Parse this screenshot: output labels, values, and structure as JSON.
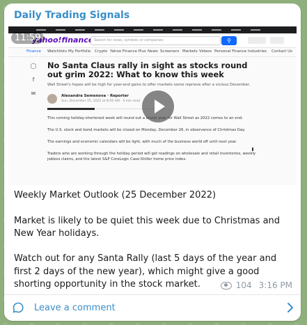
{
  "channel": {
    "name": "Daily Trading Signals"
  },
  "video": {
    "duration": "11:59",
    "screenshot": {
      "site_logo": "yahoo!finance",
      "search_placeholder": "Search for news, symbols or companies",
      "nav": [
        "Finance",
        "Watchlists",
        "My Portfolio",
        "Crypto",
        "Yahoo Finance Plus",
        "News",
        "Screeners",
        "Markets",
        "Videos",
        "Personal Finance",
        "Industries",
        "Contact Us"
      ],
      "headline": "No Santa Claus rally in sight as stocks round out grim 2022: What to know this week",
      "subhead": "Wall Street's hopes will be high for year-end gains to offer markets some reprieve after a vicious December.",
      "author": "Alexandra Semenova · Reporter",
      "date": "Sun, December 25, 2022 at 8:00 AM · 4 min read",
      "paragraphs": [
        "This coming holiday-shortened week will round out a brutal year for Wall Street as 2022 comes to an end.",
        "The U.S. stock and bond markets will be closed on Monday, December 26, in observance of Christmas Day.",
        "The earnings and economic calendars will be light, with much of the business world off until next year.",
        "Traders who are working through the holiday period will get readings on wholesale and retail inventories, weekly jobless claims, and the latest S&P CoreLogic Case-Shiller home price index."
      ]
    }
  },
  "message": {
    "paragraphs": [
      "Weekly Market Outlook (25 December 2022)",
      "Market is likely to be quiet this week due to Christmas and New Year holidays.",
      "Watch out for any Santa Rally (last 5 days of the year and first 2 days of the new year), which might give a good shorting opportunity in the stock market."
    ],
    "views": "104",
    "time": "3:16 PM"
  },
  "comments": {
    "label": "Leave a comment"
  },
  "colors": {
    "accent": "#3a8fc8",
    "meta": "#8e9aa4",
    "background": "#8fb07c"
  }
}
